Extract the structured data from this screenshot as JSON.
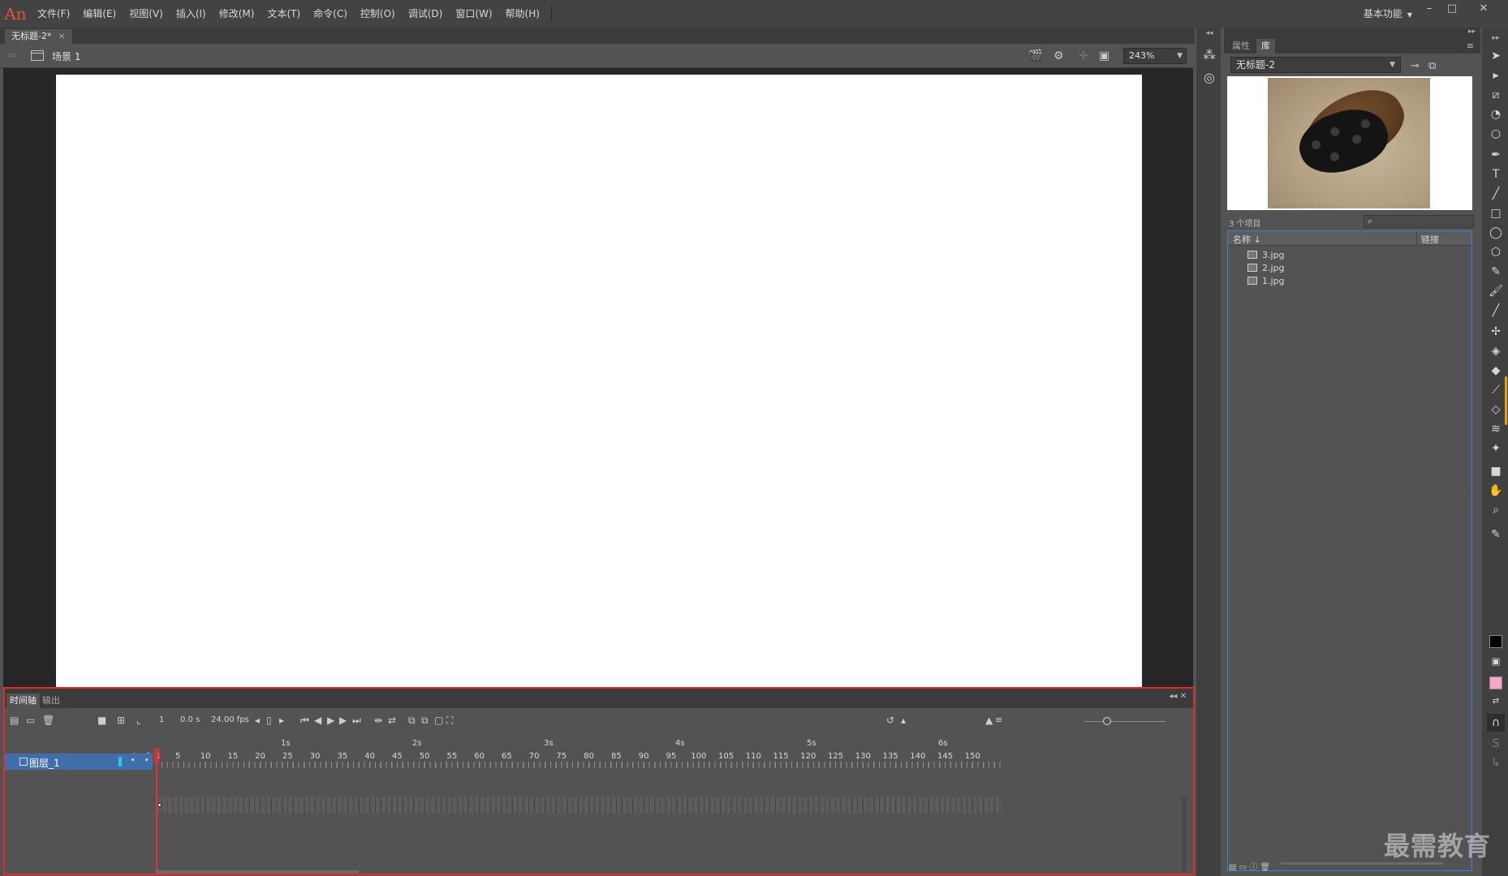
{
  "app": {
    "logo": "An"
  },
  "menu": [
    "文件(F)",
    "编辑(E)",
    "视图(V)",
    "插入(I)",
    "修改(M)",
    "文本(T)",
    "命令(C)",
    "控制(O)",
    "调试(D)",
    "窗口(W)",
    "帮助(H)"
  ],
  "workspace": {
    "label": "基本功能"
  },
  "document": {
    "tab_title": "无标题-2*",
    "scene": "场景 1",
    "zoom": "243%"
  },
  "timeline": {
    "tabs": [
      "时间轴",
      "输出"
    ],
    "current_frame": "1",
    "time": "0.0 s",
    "fps": "24.00 fps",
    "seconds": [
      "1s",
      "2s",
      "3s",
      "4s",
      "5s",
      "6s"
    ],
    "frame_numbers": [
      "1",
      "5",
      "10",
      "15",
      "20",
      "25",
      "30",
      "35",
      "40",
      "45",
      "50",
      "55",
      "60",
      "65",
      "70",
      "75",
      "80",
      "85",
      "90",
      "95",
      "100",
      "105",
      "110",
      "115",
      "120",
      "125",
      "130",
      "135",
      "140",
      "145",
      "150"
    ],
    "layer": {
      "name": "图层_1",
      "color": "#28c7f0"
    }
  },
  "library": {
    "tabs": [
      "属性",
      "库"
    ],
    "document_name": "无标题-2",
    "item_count": "3 个项目",
    "columns": {
      "name": "名称 ↓",
      "link": "链接"
    },
    "items": [
      "3.jpg",
      "2.jpg",
      "1.jpg"
    ]
  },
  "colors": {
    "stroke": "#000000",
    "fill": "#f7a8c8",
    "accent": "#3f6ea8",
    "highlight": "#e22b2b"
  },
  "watermark": "最需教育"
}
